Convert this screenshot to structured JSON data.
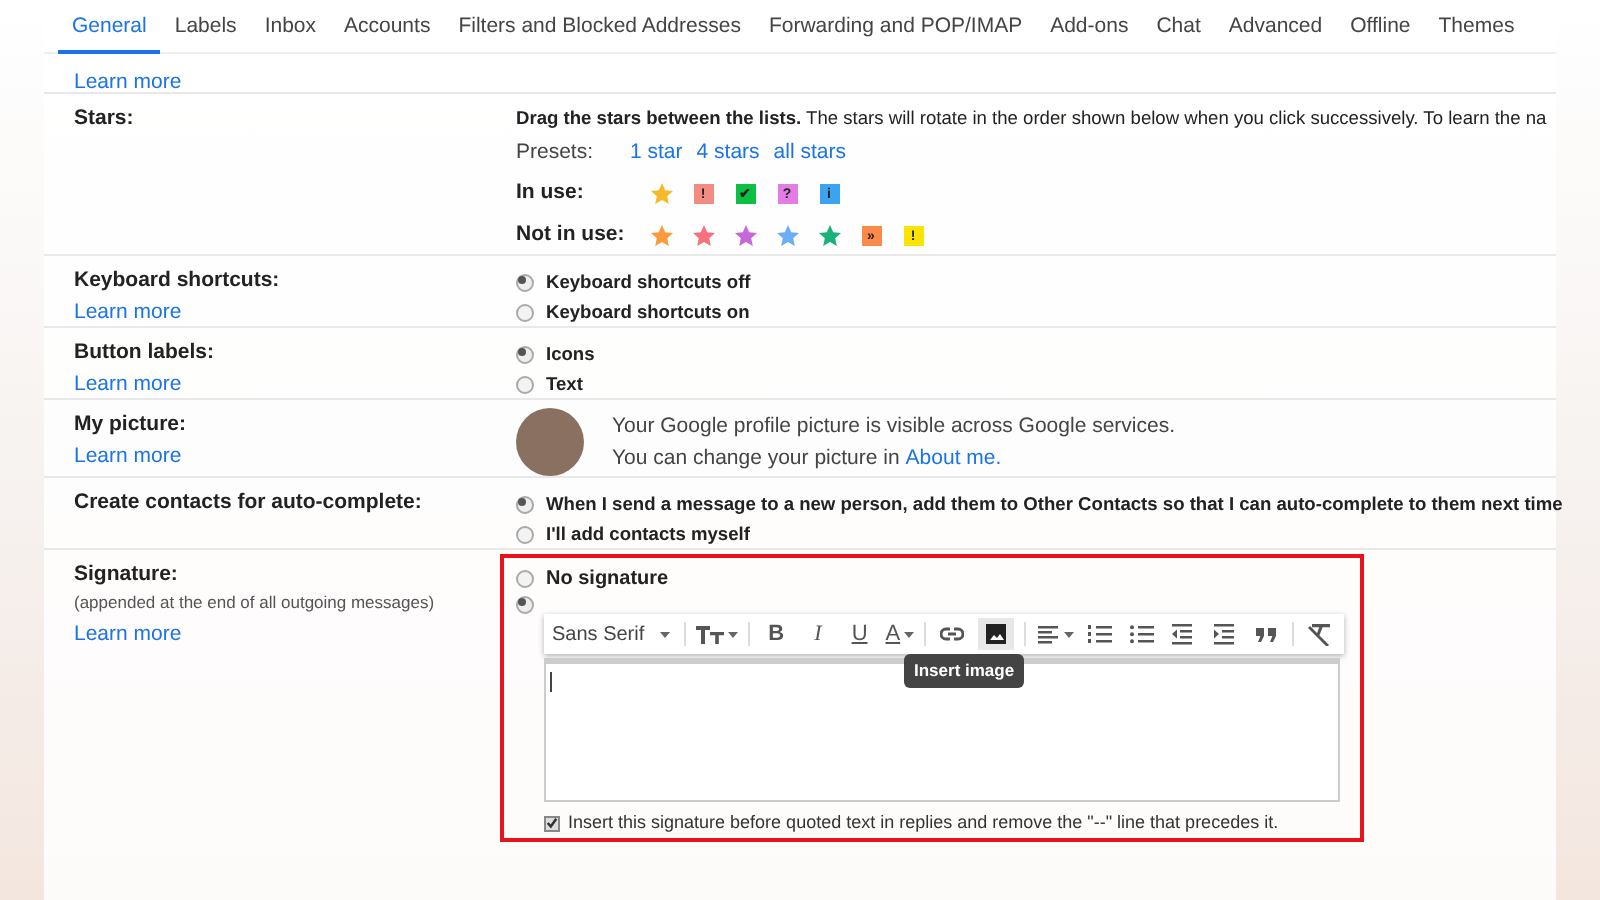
{
  "tabs": [
    {
      "label": "General",
      "selected": true
    },
    {
      "label": "Labels",
      "selected": false
    },
    {
      "label": "Inbox",
      "selected": false
    },
    {
      "label": "Accounts",
      "selected": false
    },
    {
      "label": "Filters and Blocked Addresses",
      "selected": false
    },
    {
      "label": "Forwarding and POP/IMAP",
      "selected": false
    },
    {
      "label": "Add-ons",
      "selected": false
    },
    {
      "label": "Chat",
      "selected": false
    },
    {
      "label": "Advanced",
      "selected": false
    },
    {
      "label": "Offline",
      "selected": false
    },
    {
      "label": "Themes",
      "selected": false
    }
  ],
  "top_link": "Learn more",
  "stars": {
    "label": "Stars:",
    "intro": "**Drag the stars between the lists.**  The stars will rotate in the order shown below when you click successively. To learn the na",
    "presets_label": "Presets:",
    "presets": [
      "1 star",
      "4 stars",
      "all stars"
    ],
    "in_use_label": "In use:",
    "in_use": [
      {
        "kind": "star",
        "color": "#f7b82b"
      },
      {
        "kind": "box",
        "color": "#f28b82",
        "symbol": "!"
      },
      {
        "kind": "box",
        "color": "#0cc142",
        "symbol": "✔"
      },
      {
        "kind": "box",
        "color": "#e27de6",
        "symbol": "?"
      },
      {
        "kind": "box",
        "color": "#3ba3f0",
        "symbol": "i"
      }
    ],
    "not_in_use_label": "Not in use:",
    "not_in_use": [
      {
        "kind": "star",
        "color": "#fb9a3c"
      },
      {
        "kind": "star",
        "color": "#f6717d"
      },
      {
        "kind": "star",
        "color": "#c768d8"
      },
      {
        "kind": "star",
        "color": "#6aaef5"
      },
      {
        "kind": "star",
        "color": "#17b37a"
      },
      {
        "kind": "box",
        "color": "#fb8a4a",
        "symbol": "»"
      },
      {
        "kind": "box",
        "color": "#fbe403",
        "symbol": "!"
      }
    ]
  },
  "sections": [
    {
      "kind": "radio",
      "label": "Keyboard shortcuts:",
      "link": "Learn more",
      "options": [
        {
          "label": "Keyboard shortcuts off",
          "selected": true
        },
        {
          "label": "Keyboard shortcuts on",
          "selected": false
        }
      ]
    },
    {
      "kind": "radio",
      "label": "Button labels:",
      "link": "Learn more",
      "options": [
        {
          "label": "Icons",
          "selected": true
        },
        {
          "label": "Text",
          "selected": false
        }
      ]
    },
    {
      "kind": "picture",
      "label": "My picture:",
      "link": "Learn more",
      "line_1": "Your Google profile picture is visible across Google services.",
      "line_2": "You can change your picture in",
      "line_2_link": "About me."
    },
    {
      "kind": "radio",
      "label": "Create contacts for auto-complete:",
      "options": [
        {
          "label": "When I send a message to a new person, add them to Other Contacts so that I can auto-complete to them next time",
          "selected": true
        },
        {
          "label": "I'll add contacts myself",
          "selected": false
        }
      ]
    }
  ],
  "signature": {
    "label": "Signature:",
    "note": "(appended at the end of all outgoing messages)",
    "link": "Learn more",
    "no_signature": {
      "label": "No signature",
      "selected": false
    },
    "custom_selected": true,
    "toolbar": {
      "font": "Sans Serif",
      "bold": "B",
      "italic": "I",
      "underline": "U",
      "text_color": "A"
    },
    "tooltip": "Insert image",
    "insert_before_quoted": {
      "label": "Insert this signature before quoted text in replies and remove the \"--\" line that precedes it.",
      "checked": true
    }
  }
}
